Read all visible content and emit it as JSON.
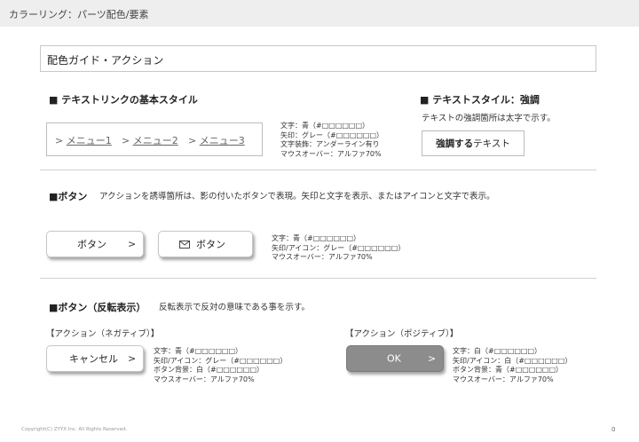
{
  "header": {
    "title": "カラーリング：パーツ配色/要素"
  },
  "guide": {
    "title": "配色ガイド・アクション"
  },
  "text_links": {
    "heading": "■ テキストリンクの基本スタイル",
    "links": [
      {
        "prefix": ">",
        "label": "メニュー1"
      },
      {
        "prefix": ">",
        "label": "メニュー2"
      },
      {
        "prefix": ">",
        "label": "メニュー3"
      }
    ],
    "spec": [
      "文字：青（#□□□□□□）",
      "矢印：グレー（#□□□□□□）",
      "文字装飾：アンダーライン有り",
      "マウスオーバー：アルファ70%"
    ]
  },
  "text_style": {
    "heading": "■ テキストスタイル：強調",
    "description": "テキストの強調箇所は太字で示す。",
    "sample_bold": "強調する",
    "sample_normal": "テキスト"
  },
  "buttons": {
    "heading": "■ボタン",
    "description": "アクションを誘導箇所は、影の付いたボタンで表現。矢印と文字を表示、またはアイコンと文字で表示。",
    "button1_label": "ボタン",
    "button1_arrow": ">",
    "button2_label": "ボタン",
    "button2_icon": "envelope-icon",
    "spec": [
      "文字：青（#□□□□□□）",
      "矢印/アイコン：グレー（#□□□□□□）",
      "マウスオーバー：アルファ70%"
    ]
  },
  "inverted": {
    "heading": "■ボタン（反転表示）",
    "description": "反転表示で反対の意味である事を示す。",
    "negative": {
      "title": "【アクション（ネガティブ）】",
      "button_label": "キャンセル",
      "button_arrow": ">",
      "spec": [
        "文字：青（#□□□□□□）",
        "矢印/アイコン：グレー（#□□□□□□）",
        "ボタン背景：白（#□□□□□□）",
        "マウスオーバー：アルファ70%"
      ]
    },
    "positive": {
      "title": "【アクション（ポジティブ）】",
      "button_label": "OK",
      "button_arrow": ">",
      "spec": [
        "文字：白（#□□□□□□）",
        "矢印/アイコン：白（#□□□□□□）",
        "ボタン背景：青（#□□□□□□）",
        "マウスオーバー：アルファ70%"
      ]
    }
  },
  "footer": {
    "copyright": "Copyright(C) ZYYX Inc. All Rights Reserved.",
    "page": "0"
  },
  "colors": {
    "positive_button_bg": "#8c8c8c",
    "topbar_bg": "#eeeeee"
  }
}
